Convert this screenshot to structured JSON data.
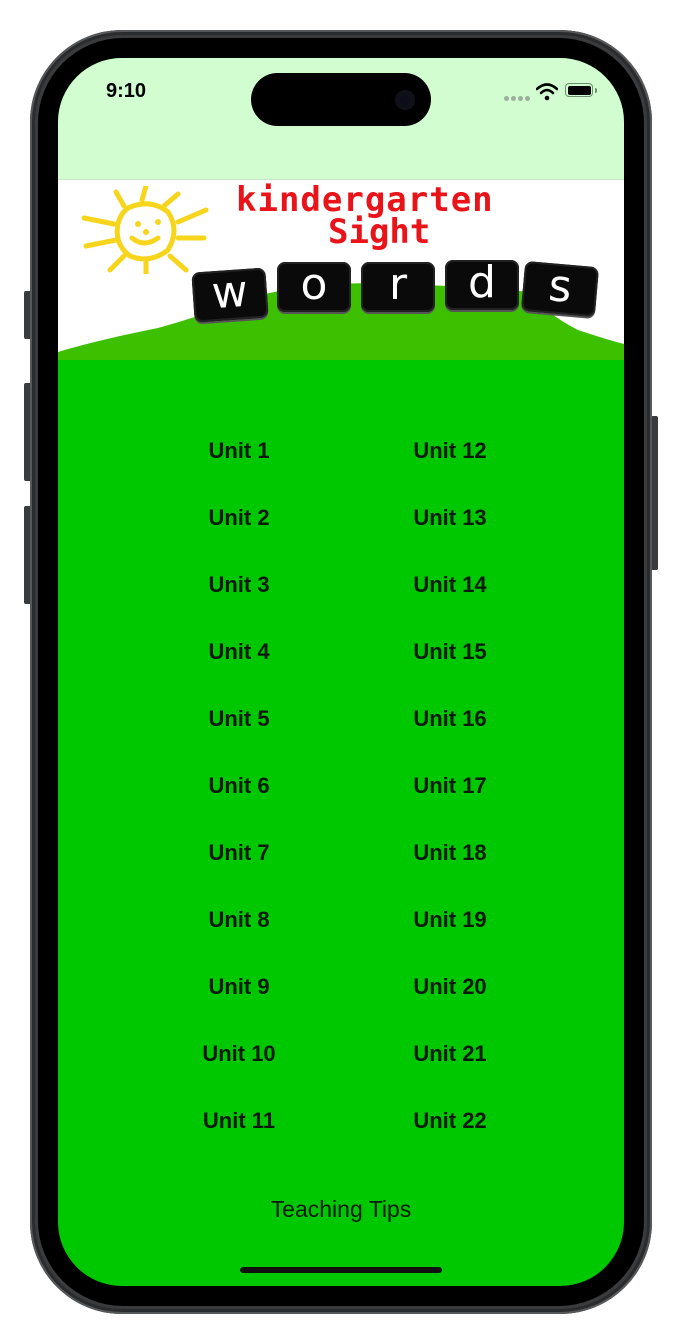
{
  "status_bar": {
    "time": "9:10",
    "icons": [
      "cellular-signal-icon",
      "wifi-icon",
      "battery-icon"
    ]
  },
  "banner": {
    "line1": "kindergarten",
    "line2": "Sight",
    "tiles": [
      "w",
      "o",
      "r",
      "d",
      "s"
    ],
    "colors": {
      "title": "#e8141a",
      "sun": "#f7d51d",
      "hill": "#3cc000",
      "sky": "#ffffff"
    }
  },
  "units": {
    "left": [
      "Unit 1",
      "Unit 2",
      "Unit 3",
      "Unit 4",
      "Unit 5",
      "Unit 6",
      "Unit 7",
      "Unit 8",
      "Unit 9",
      "Unit 10",
      "Unit 11"
    ],
    "right": [
      "Unit 12",
      "Unit 13",
      "Unit 14",
      "Unit 15",
      "Unit 16",
      "Unit 17",
      "Unit 18",
      "Unit 19",
      "Unit 20",
      "Unit 21",
      "Unit 22"
    ]
  },
  "footer": {
    "tips_label": "Teaching Tips"
  },
  "colors": {
    "background": "#00c800",
    "status_bar": "#d1fdd0",
    "text": "#0a1a0a"
  }
}
